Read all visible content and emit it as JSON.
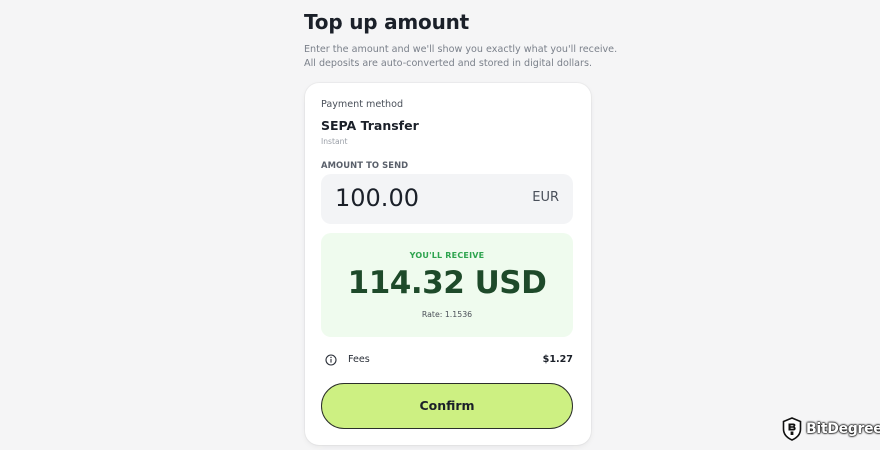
{
  "header": {
    "title": "Top up amount",
    "subtitle": "Enter the amount and we'll show you exactly what you'll receive. All deposits are auto-converted and stored in digital dollars."
  },
  "payment_method": {
    "label": "Payment method",
    "value": "SEPA Transfer",
    "speed": "Instant"
  },
  "amount_to_send": {
    "label": "AMOUNT TO SEND",
    "value": "100.00",
    "currency": "EUR"
  },
  "receive": {
    "label": "YOU'LL RECEIVE",
    "value": "114.32 USD",
    "rate": "Rate: 1.1536"
  },
  "fees": {
    "icon": "info-icon",
    "label": "Fees",
    "value": "$1.27"
  },
  "actions": {
    "confirm_label": "Confirm"
  },
  "watermark": {
    "text": "BitDegree",
    "icon": "bitdegree-shield-logo"
  },
  "colors": {
    "page_background": "#f5f5f6",
    "card_background": "#ffffff",
    "amount_box_background": "#f3f4f6",
    "receive_box_background": "#effbee",
    "receive_label": "#2ea44f",
    "receive_value": "#1e4a2a",
    "confirm_button": "#cdf082"
  }
}
